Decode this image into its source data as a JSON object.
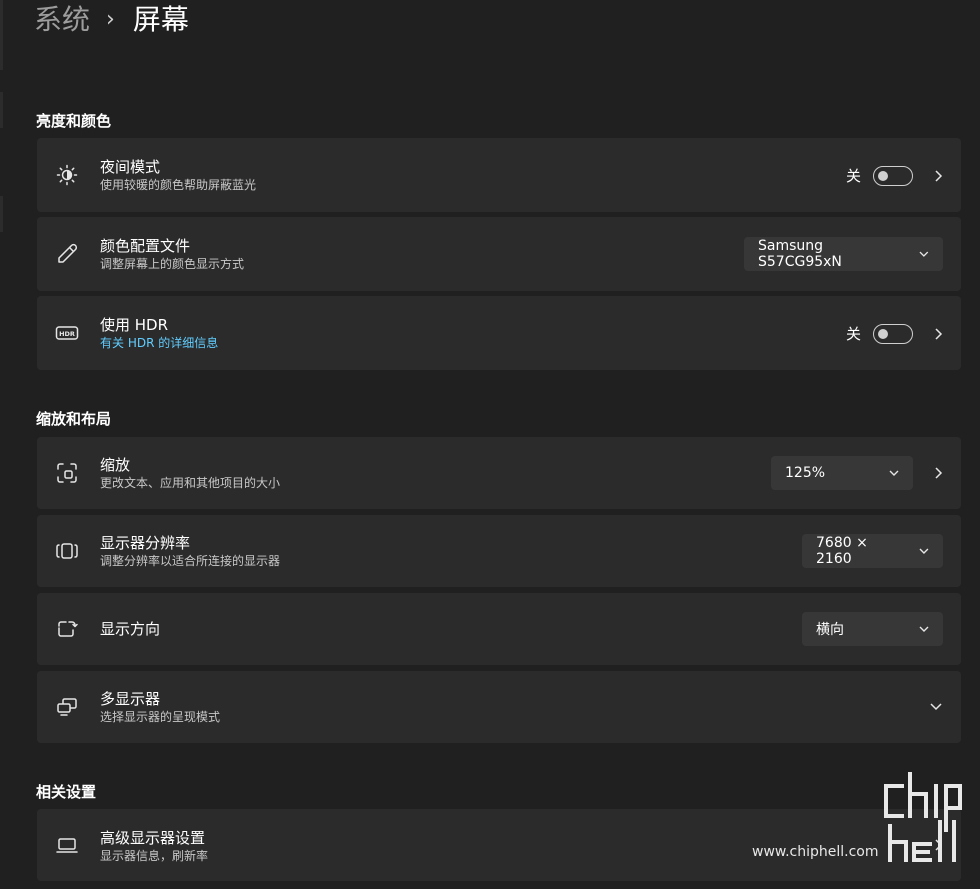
{
  "breadcrumb": {
    "parent": "系统",
    "separator": "›",
    "current": "屏幕"
  },
  "sections": {
    "brightness": "亮度和颜色",
    "scale": "缩放和布局",
    "related": "相关设置"
  },
  "rows": {
    "night_light": {
      "title": "夜间模式",
      "subtitle": "使用较暖的颜色帮助屏蔽蓝光",
      "toggle_label": "关",
      "toggle_on": false,
      "icon": "brightness-icon"
    },
    "color_profile": {
      "title": "颜色配置文件",
      "subtitle": "调整屏幕上的颜色显示方式",
      "value": "Samsung S57CG95xN",
      "icon": "eyedropper-icon"
    },
    "hdr": {
      "title": "使用 HDR",
      "subtitle_link": "有关 HDR 的详细信息",
      "toggle_label": "关",
      "toggle_on": false,
      "icon": "hdr-icon"
    },
    "scale": {
      "title": "缩放",
      "subtitle": "更改文本、应用和其他项目的大小",
      "value": "125%",
      "icon": "scale-icon"
    },
    "resolution": {
      "title": "显示器分辨率",
      "subtitle": "调整分辨率以适合所连接的显示器",
      "value": "7680 × 2160",
      "icon": "resolution-icon"
    },
    "orientation": {
      "title": "显示方向",
      "value": "横向",
      "icon": "orientation-icon"
    },
    "multi_display": {
      "title": "多显示器",
      "subtitle": "选择显示器的呈现模式",
      "icon": "multi-display-icon"
    },
    "advanced": {
      "title": "高级显示器设置",
      "subtitle": "显示器信息，刷新率",
      "icon": "laptop-icon"
    }
  },
  "watermark": {
    "url": "www.chiphell.com",
    "logo_text": "chip hell"
  },
  "colors": {
    "background": "#202020",
    "card": "#2b2b2b",
    "dropdown": "#373737",
    "link": "#60cdff"
  }
}
